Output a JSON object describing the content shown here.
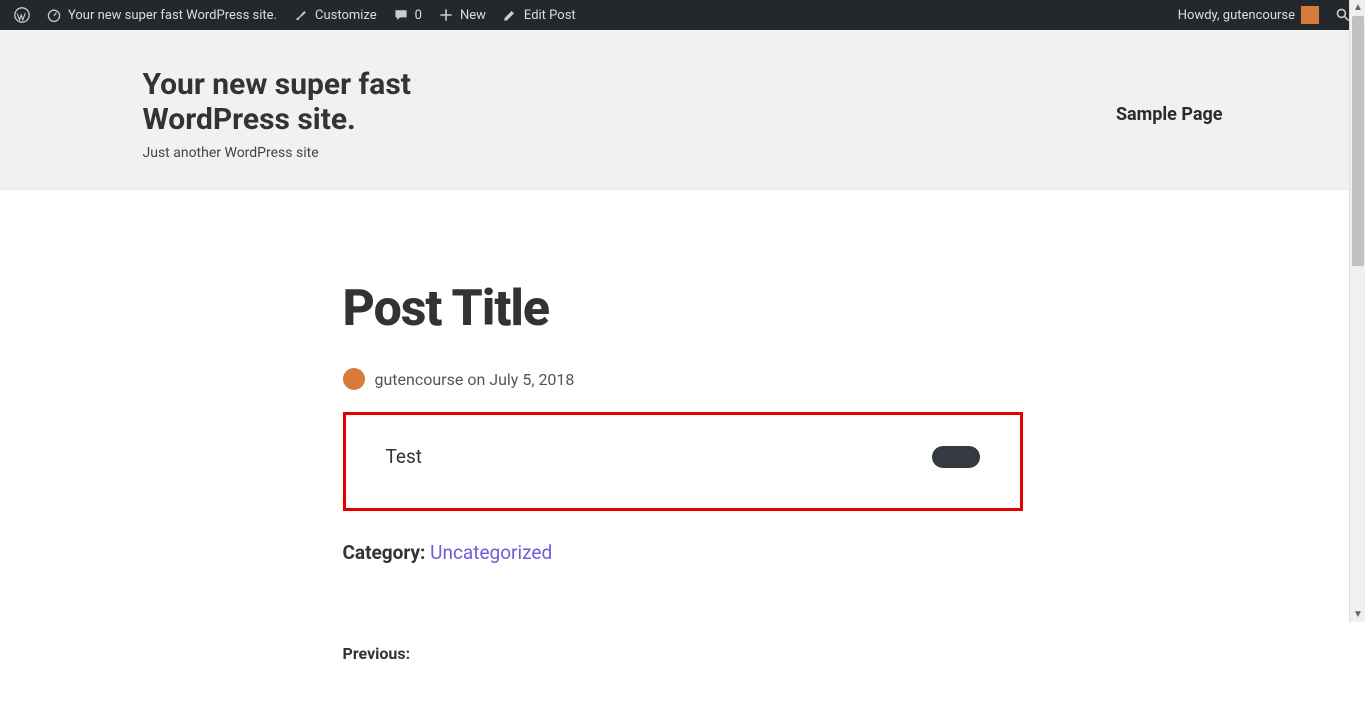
{
  "adminbar": {
    "site_name": "Your new super fast WordPress site.",
    "customize": "Customize",
    "comments_count": "0",
    "new": "New",
    "edit_post": "Edit Post",
    "greeting": "Howdy, gutencourse"
  },
  "header": {
    "site_title": "Your new super fast WordPress site.",
    "tagline": "Just another WordPress site",
    "nav_item": "Sample Page"
  },
  "post": {
    "title": "Post Title",
    "author": "gutencourse",
    "date_prefix": "on",
    "date": "July 5, 2018",
    "content_text": "Test",
    "category_label": "Category:",
    "category_value": "Uncategorized",
    "previous_label": "Previous:"
  }
}
